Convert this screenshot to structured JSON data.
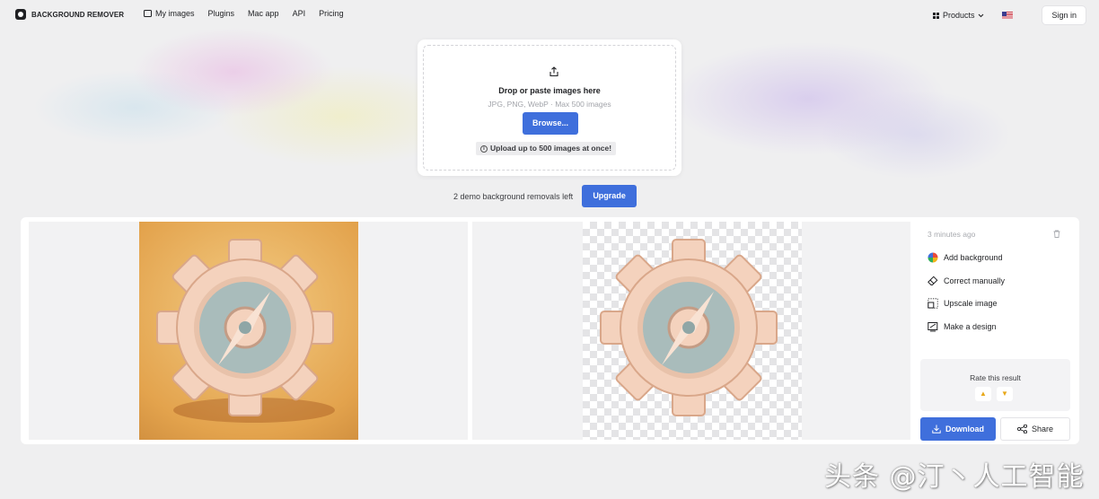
{
  "header": {
    "brand": "BACKGROUND REMOVER",
    "nav": [
      "My images",
      "Plugins",
      "Mac app",
      "API",
      "Pricing"
    ],
    "products_label": "Products",
    "signin_label": "Sign in"
  },
  "upload": {
    "title": "Drop or paste images here",
    "subtitle": "JPG, PNG, WebP · Max 500 images",
    "browse_label": "Browse...",
    "note": "Upload up to 500 images at once!"
  },
  "demo": {
    "text": "2 demo background removals left",
    "upgrade_label": "Upgrade"
  },
  "result": {
    "timestamp": "3 minutes ago",
    "actions": [
      "Add background",
      "Correct manually",
      "Upscale image",
      "Make a design"
    ],
    "rate_title": "Rate this result",
    "download_label": "Download",
    "share_label": "Share"
  },
  "colors": {
    "accent": "#3f6fdc"
  },
  "watermark": "头条 @汀丶人工智能"
}
